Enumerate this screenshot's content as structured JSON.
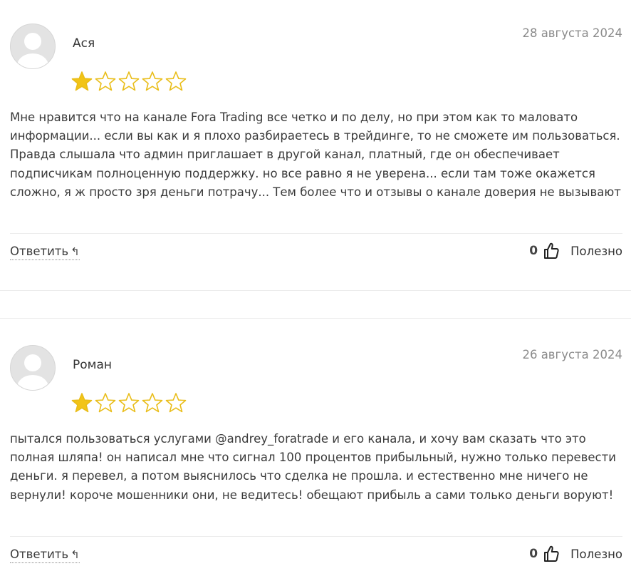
{
  "reviews": [
    {
      "author": "Ася",
      "date": "28 августа 2024",
      "rating": 1,
      "max_rating": 5,
      "text": "Мне нравится что на канале Fora Trading все четко и по делу, но при этом как то маловато информации... если вы как и я плохо разбираетесь в трейдинге, то не сможете им пользоваться. Правда слышала что админ приглашает в другой канал, платный, где он обеспечивает подписчикам полноценную поддержку. но все равно я не уверена... если там тоже окажется сложно, я ж просто зря деньги потрачу... Тем более что и отзывы о канале доверия не вызывают",
      "reply_label": "Ответить",
      "helpful_count": "0",
      "helpful_label": "Полезно"
    },
    {
      "author": "Роман",
      "date": "26 августа 2024",
      "rating": 1,
      "max_rating": 5,
      "text": "пытался пользоваться услугами @andrey_foratrade и его канала, и хочу вам сказать что это полная шляпа! он написал мне что сигнал 100 процентов прибыльный, нужно только перевести деньги. я перевел, а потом выяснилось что сделка не прошла. и естественно мне ничего не вернули! короче мошенники они, не ведитесь! обещают прибыль а сами только деньги воруют!",
      "reply_label": "Ответить",
      "helpful_count": "0",
      "helpful_label": "Полезно"
    }
  ],
  "colors": {
    "star_fill": "#f2c417",
    "star_outline": "#e9bd18",
    "avatar_bg": "#e3e3e3",
    "avatar_figure": "#ffffff",
    "divider": "#ececec",
    "date": "#8a8a8a"
  },
  "icons": {
    "reply": "reply-arrow-icon",
    "helpful": "thumbs-up-icon",
    "star": "star-icon",
    "avatar": "user-silhouette-icon"
  }
}
